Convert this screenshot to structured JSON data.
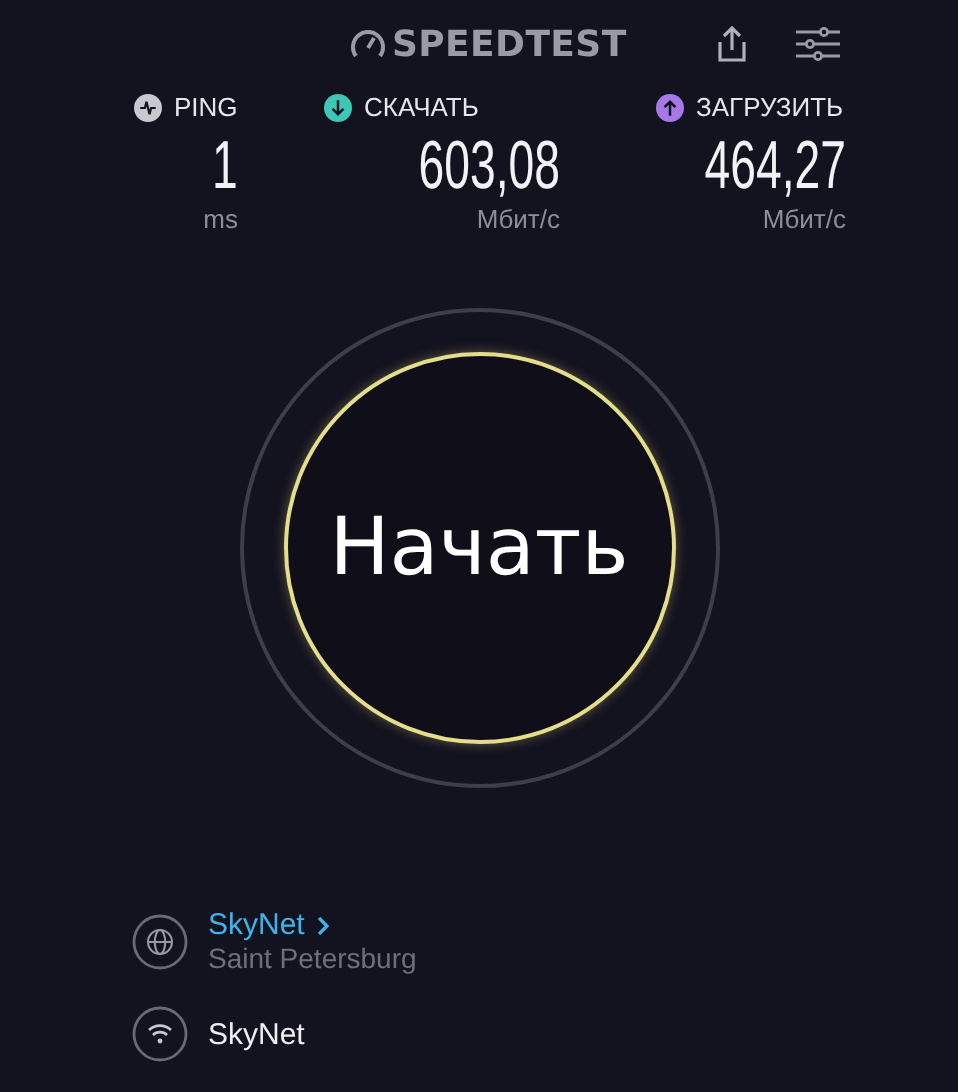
{
  "header": {
    "logo": "SPEEDTEST"
  },
  "metrics": [
    {
      "kind": "ping",
      "label": "PING",
      "value": "1",
      "unit": "ms",
      "color": "#c8c8d0"
    },
    {
      "kind": "download",
      "label": "СКАЧАТЬ",
      "value": "603,08",
      "unit": "Мбит/с",
      "color": "#3cc8b4"
    },
    {
      "kind": "upload",
      "label": "ЗАГРУЗИТЬ",
      "value": "464,27",
      "unit": "Мбит/с",
      "color": "#a678e8"
    }
  ],
  "start_button": {
    "label": "Начать"
  },
  "server": {
    "provider": "SkyNet",
    "location": "Saint Petersburg"
  },
  "connection": {
    "name": "SkyNet"
  }
}
